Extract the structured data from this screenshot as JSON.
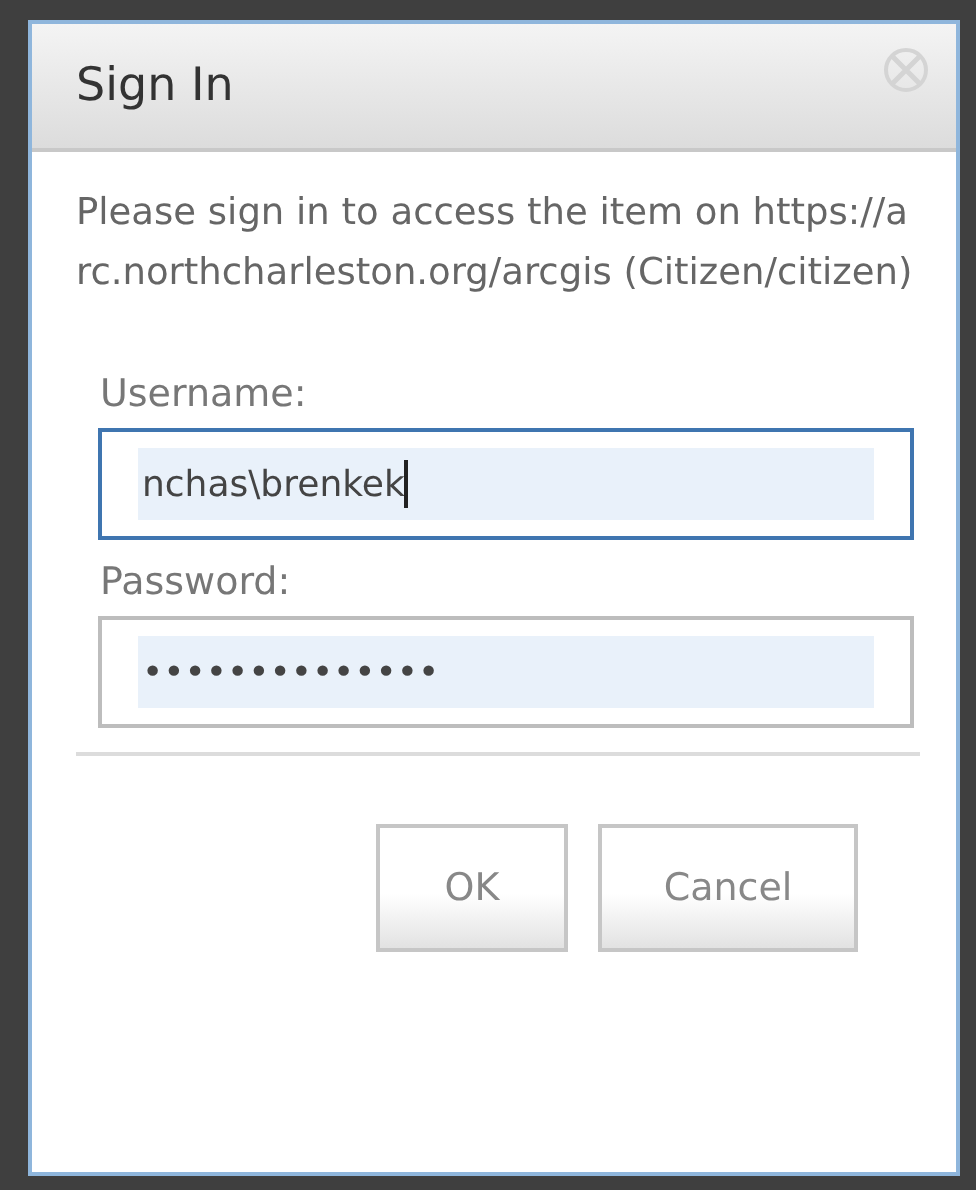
{
  "dialog": {
    "title": "Sign In",
    "message": "Please sign in to access the item on https://arc.northcharleston.org/arcgis (Citizen/citizen)",
    "fields": [
      {
        "label": "Username:",
        "value": "nchas\\brenkek",
        "focused": true
      },
      {
        "label": "Password:",
        "value": "••••••••••••••",
        "focused": false
      }
    ],
    "buttons": [
      "OK",
      "Cancel"
    ]
  }
}
